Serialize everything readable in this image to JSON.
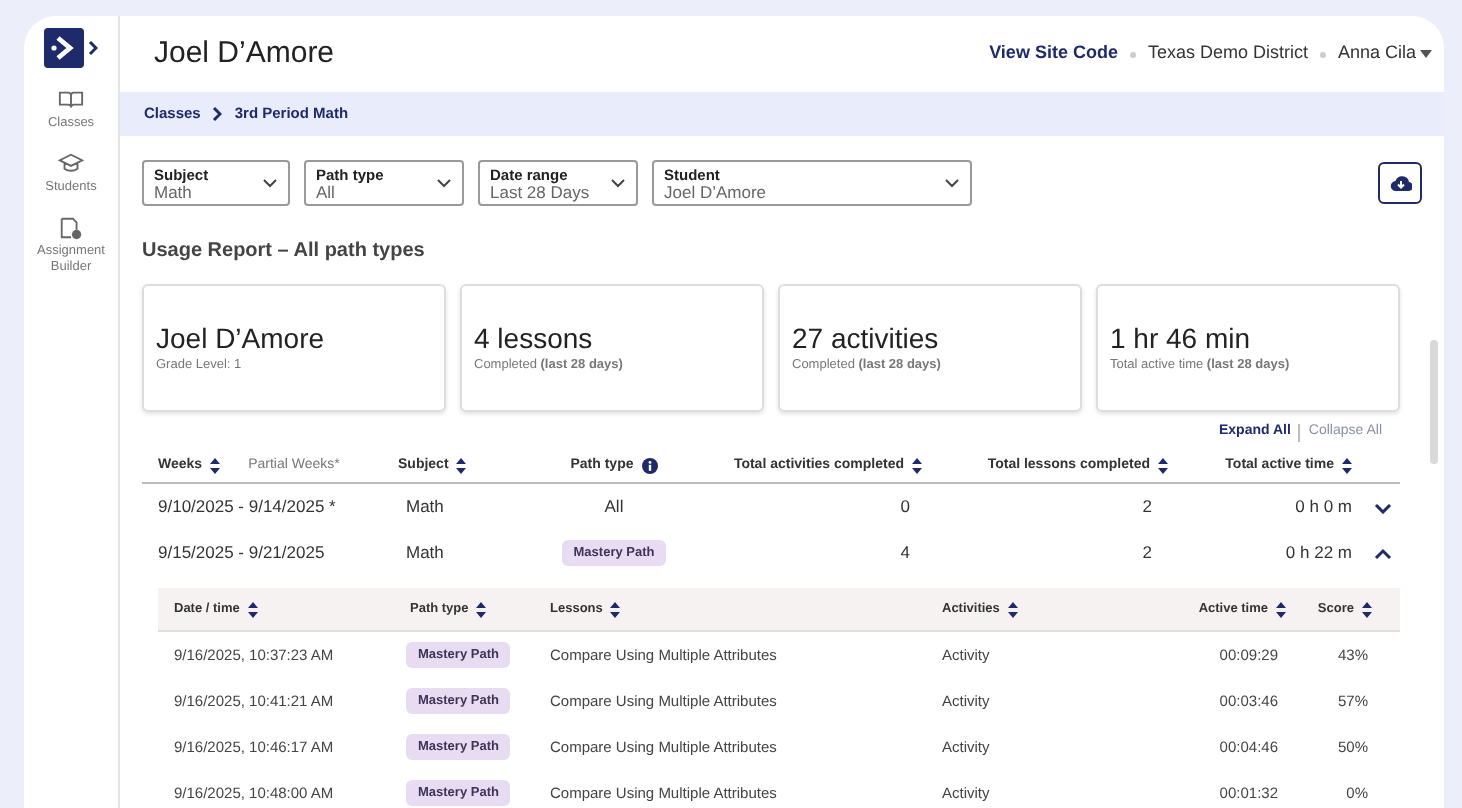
{
  "sidebar": {
    "items": [
      {
        "label": "Classes"
      },
      {
        "label": "Students"
      },
      {
        "label": "Assignment Builder"
      }
    ]
  },
  "header": {
    "title": "Joel D’Amore",
    "site_code": "View Site Code",
    "district": "Texas Demo District",
    "user": "Anna Cila"
  },
  "breadcrumb": [
    "Classes",
    "3rd Period Math"
  ],
  "filters": [
    {
      "label": "Subject",
      "value": "Math"
    },
    {
      "label": "Path type",
      "value": "All"
    },
    {
      "label": "Date range",
      "value": "Last 28 Days"
    },
    {
      "label": "Student",
      "value": "Joel D’Amore"
    }
  ],
  "report_title": "Usage Report – All path types",
  "summary_cards": [
    {
      "title": "Joel D’Amore",
      "subtitle": "Grade Level: 1"
    },
    {
      "title": "4 lessons",
      "subtitle": "Completed **(last 28 days)**"
    },
    {
      "title": "27 activities",
      "subtitle": "Completed **(last 28 days)**"
    },
    {
      "title": "1 hr 46 min",
      "subtitle": "Total active time **(last 28 days)**"
    }
  ],
  "expand_all": "Expand All",
  "collapse_all": "Collapse All",
  "table": {
    "columns": [
      {
        "label": "Weeks",
        "kind": "sortable"
      },
      {
        "label": "Partial Weeks*",
        "kind": "note"
      },
      {
        "label": "Subject",
        "kind": "sortable"
      },
      {
        "label": "Path type",
        "kind": "info"
      },
      {
        "label": "Total activities completed",
        "kind": "sortable"
      },
      {
        "label": "Total lessons completed",
        "kind": "sortable"
      },
      {
        "label": "Total active time",
        "kind": "sortable"
      }
    ],
    "rows": [
      {
        "weeks": "9/10/2025 - 9/14/2025 *",
        "subject": "Math",
        "path_type": "All",
        "kind": "summary",
        "activities": "0",
        "lessons": "2",
        "time": "0 h 0 m",
        "expanded": false
      },
      {
        "weeks": "9/15/2025 - 9/21/2025",
        "subject": "Math",
        "path_type": "Mastery Path",
        "kind": "path",
        "activities": "4",
        "lessons": "2",
        "time": "0 h 22 m",
        "expanded": true
      }
    ]
  },
  "detail_table": {
    "columns": [
      "Date / time",
      "Path type",
      "Lessons",
      "Activities",
      "Active time",
      "Score"
    ],
    "rows": [
      [
        "9/16/2025, 10:37:23 AM",
        "Mastery Path",
        "Compare Using Multiple Attributes",
        "Activity",
        "00:09:29",
        "43%"
      ],
      [
        "9/16/2025, 10:41:21 AM",
        "Mastery Path",
        "Compare Using Multiple Attributes",
        "Activity",
        "00:03:46",
        "57%"
      ],
      [
        "9/16/2025, 10:46:17 AM",
        "Mastery Path",
        "Compare Using Multiple Attributes",
        "Activity",
        "00:04:46",
        "50%"
      ],
      [
        "9/16/2025, 10:48:00 AM",
        "Mastery Path",
        "Compare Using Multiple Attributes",
        "Activity",
        "00:01:32",
        "0%"
      ]
    ]
  }
}
